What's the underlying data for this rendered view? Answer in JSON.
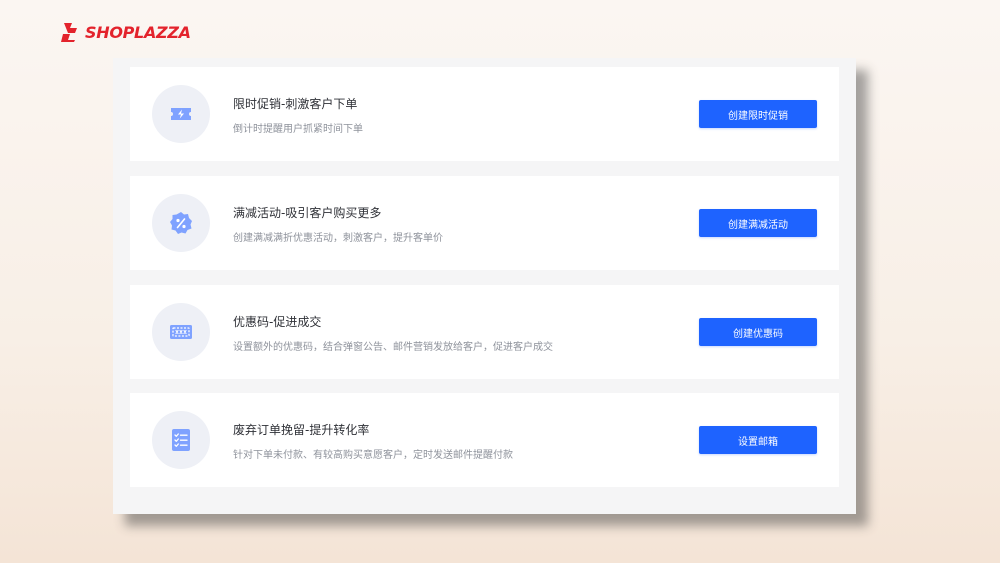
{
  "brand": {
    "name": "SHOPLAZZA",
    "color": "#e3232c"
  },
  "accent": "#1e63ff",
  "cards": [
    {
      "icon": "flash-ticket-icon",
      "title": "限时促销-刺激客户下单",
      "description": "倒计时提醒用户抓紧时间下单",
      "button_label": "创建限时促销"
    },
    {
      "icon": "discount-badge-icon",
      "title": "满减活动-吸引客户购买更多",
      "description": "创建满减满折优惠活动，刺激客户，提升客单价",
      "button_label": "创建满减活动"
    },
    {
      "icon": "coupon-code-icon",
      "title": "优惠码-促进成交",
      "description": "设置额外的优惠码，结合弹窗公告、邮件营销发放给客户，促进客户成交",
      "button_label": "创建优惠码"
    },
    {
      "icon": "checklist-icon",
      "title": "废弃订单挽留-提升转化率",
      "description": "针对下单未付款、有较高购买意愿客户，定时发送邮件提醒付款",
      "button_label": "设置邮箱"
    }
  ]
}
